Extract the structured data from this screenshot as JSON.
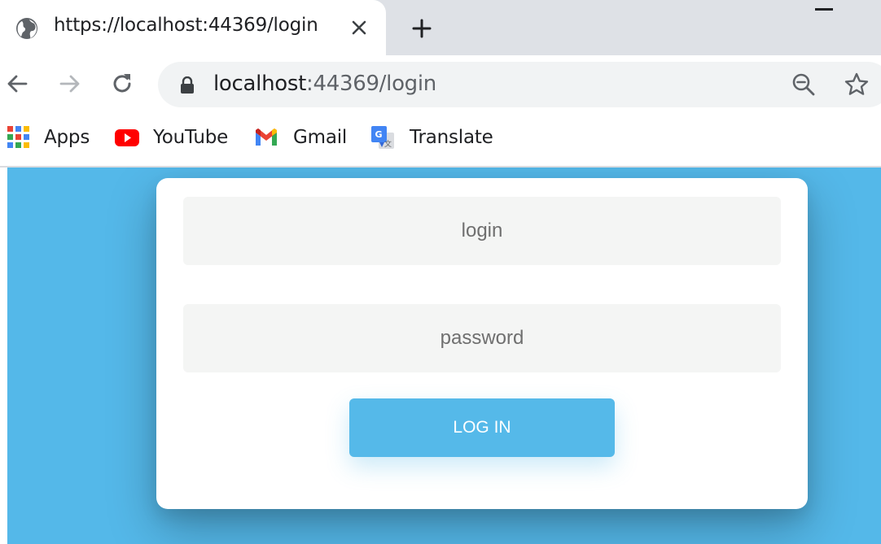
{
  "tab": {
    "title": "https://localhost:44369/login"
  },
  "address_bar": {
    "host": "localhost",
    "rest": ":44369/login"
  },
  "bookmarks": [
    {
      "label": "Apps",
      "icon": "apps-grid-icon"
    },
    {
      "label": "YouTube",
      "icon": "youtube-icon"
    },
    {
      "label": "Gmail",
      "icon": "gmail-icon"
    },
    {
      "label": "Translate",
      "icon": "google-translate-icon"
    }
  ],
  "login_form": {
    "login_placeholder": "login",
    "password_placeholder": "password",
    "login_value": "",
    "password_value": "",
    "submit_label": "LOG IN"
  },
  "colors": {
    "page_background": "#54b8e9",
    "button_background": "#55b9e9",
    "field_background": "#f4f5f4"
  }
}
